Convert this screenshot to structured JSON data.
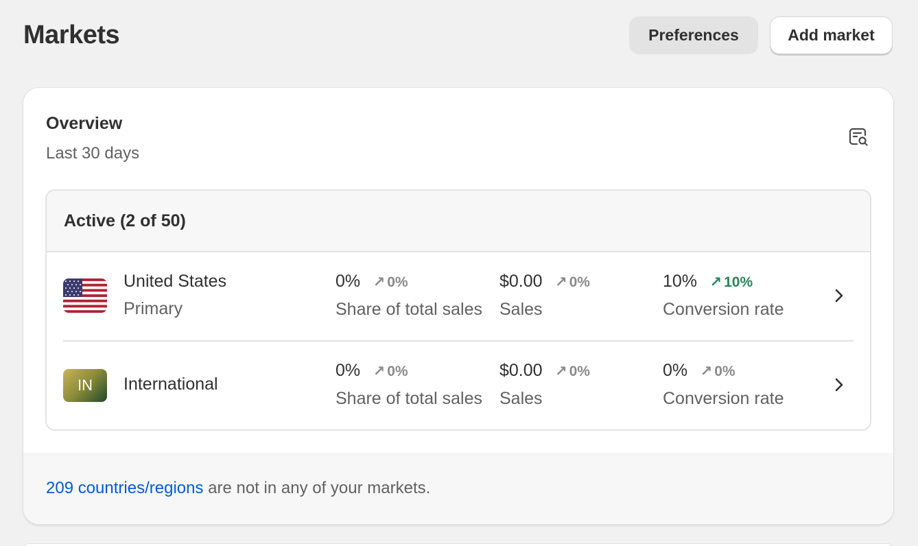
{
  "header": {
    "title": "Markets",
    "preferences_label": "Preferences",
    "add_market_label": "Add market"
  },
  "overview": {
    "title": "Overview",
    "subtitle": "Last 30 days",
    "icon": "chart-search-icon"
  },
  "active": {
    "heading": "Active (2 of 50)"
  },
  "markets": [
    {
      "name": "United States",
      "subtitle": "Primary",
      "flag": "us-flag",
      "share_value": "0%",
      "share_change": "0%",
      "share_label": "Share of total sales",
      "sales_value": "$0.00",
      "sales_change": "0%",
      "sales_label": "Sales",
      "conv_value": "10%",
      "conv_change": "10%",
      "conv_label": "Conversion rate"
    },
    {
      "name": "International",
      "badge": "IN",
      "share_value": "0%",
      "share_change": "0%",
      "share_label": "Share of total sales",
      "sales_value": "$0.00",
      "sales_change": "0%",
      "sales_label": "Sales",
      "conv_value": "0%",
      "conv_change": "0%",
      "conv_label": "Conversion rate"
    }
  ],
  "footer": {
    "link_text": "209 countries/regions",
    "text": " are not in any of your markets."
  },
  "colors": {
    "link": "#005bd3",
    "positive": "#29845a",
    "neutral_change": "#8a8a8a"
  }
}
